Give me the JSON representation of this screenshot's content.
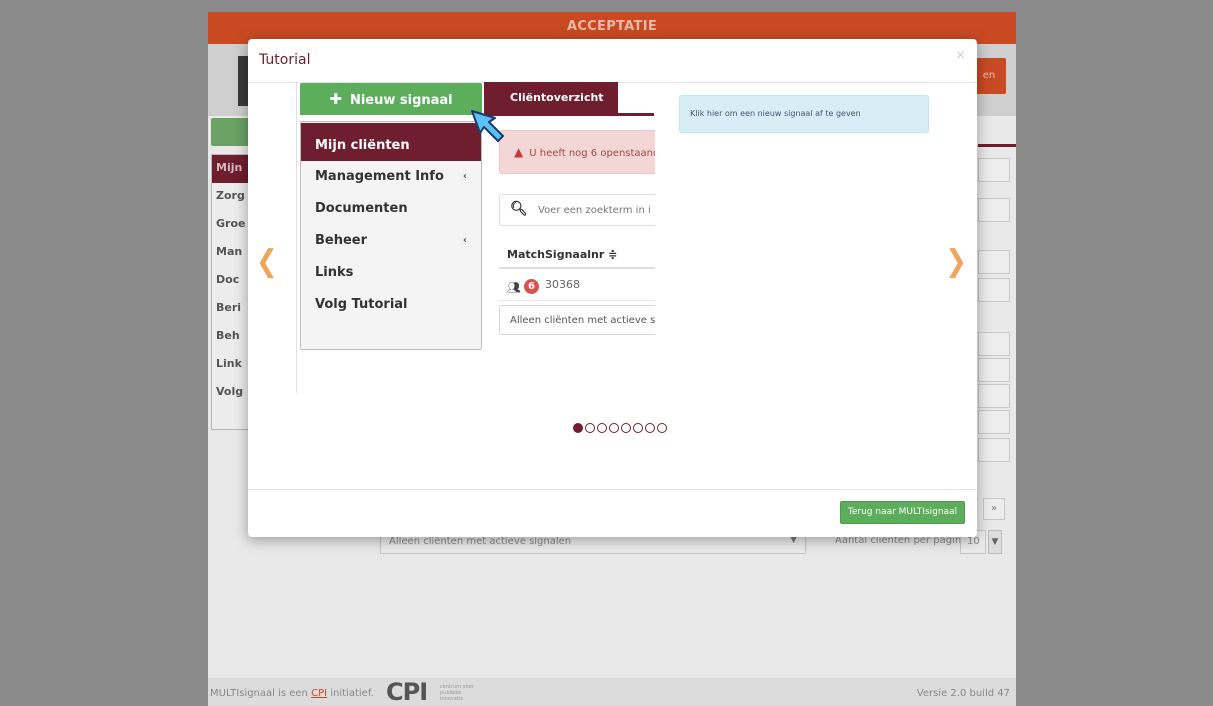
{
  "background": {
    "env_banner": "ACCEPTATIE",
    "header_button_text": "en",
    "sidebar_head": "Mijn",
    "sidebar_items": [
      "Zorg",
      "Groe",
      "Man",
      "Doc",
      "Beri",
      "Beh",
      "Link",
      "Volg"
    ],
    "filter_select": "Alleen cliënten met actieve signalen",
    "per_page_label": "Aantal cliënten per pagina:",
    "per_page_value": "10",
    "footer_text_before": "MULTIsignaal is een",
    "footer_cpi_link": "CPI",
    "footer_text_after": "initiatief.",
    "footer_logo": "CPI",
    "footer_logo_sub": "centrum voor publieke innovatie",
    "footer_version": "Versie 2.0 build 47"
  },
  "modal": {
    "title": "Tutorial",
    "close_symbol": "×",
    "footer_button": "Terug naar MULTIsignaal",
    "prev_arrow": "❮",
    "next_arrow": "❯",
    "slide": {
      "new_signal_button": "Nieuw signaal",
      "menu": {
        "head": "Mijn cliënten",
        "items": [
          {
            "label": "Management Info",
            "chevron": "‹"
          },
          {
            "label": "Documenten",
            "chevron": ""
          },
          {
            "label": "Beheer",
            "chevron": "‹"
          },
          {
            "label": "Links",
            "chevron": ""
          },
          {
            "label": "Volg Tutorial",
            "chevron": ""
          }
        ]
      },
      "tab_label": "Cliëntoverzicht",
      "alert_text": "U heeft nog 6 openstaand",
      "search_placeholder": "Voer een zoekterm in i",
      "table": {
        "headers": [
          "Match",
          "Signaalnr ≑"
        ],
        "row": {
          "badge": "6",
          "signaalnr": "30368"
        }
      },
      "filter_text": "Alleen cliënten met actieve sig",
      "hint_text": "Klik hier om een nieuw signaal af te geven"
    },
    "carousel": {
      "total_slides": 8,
      "active_index": 0
    }
  },
  "colors": {
    "brand": "#6e1e2e",
    "success": "#5cae5c",
    "banner": "#c94a22",
    "arrow": "#f0a45a",
    "info_bg": "#d9edf7",
    "danger_bg": "#f3d7d7"
  }
}
